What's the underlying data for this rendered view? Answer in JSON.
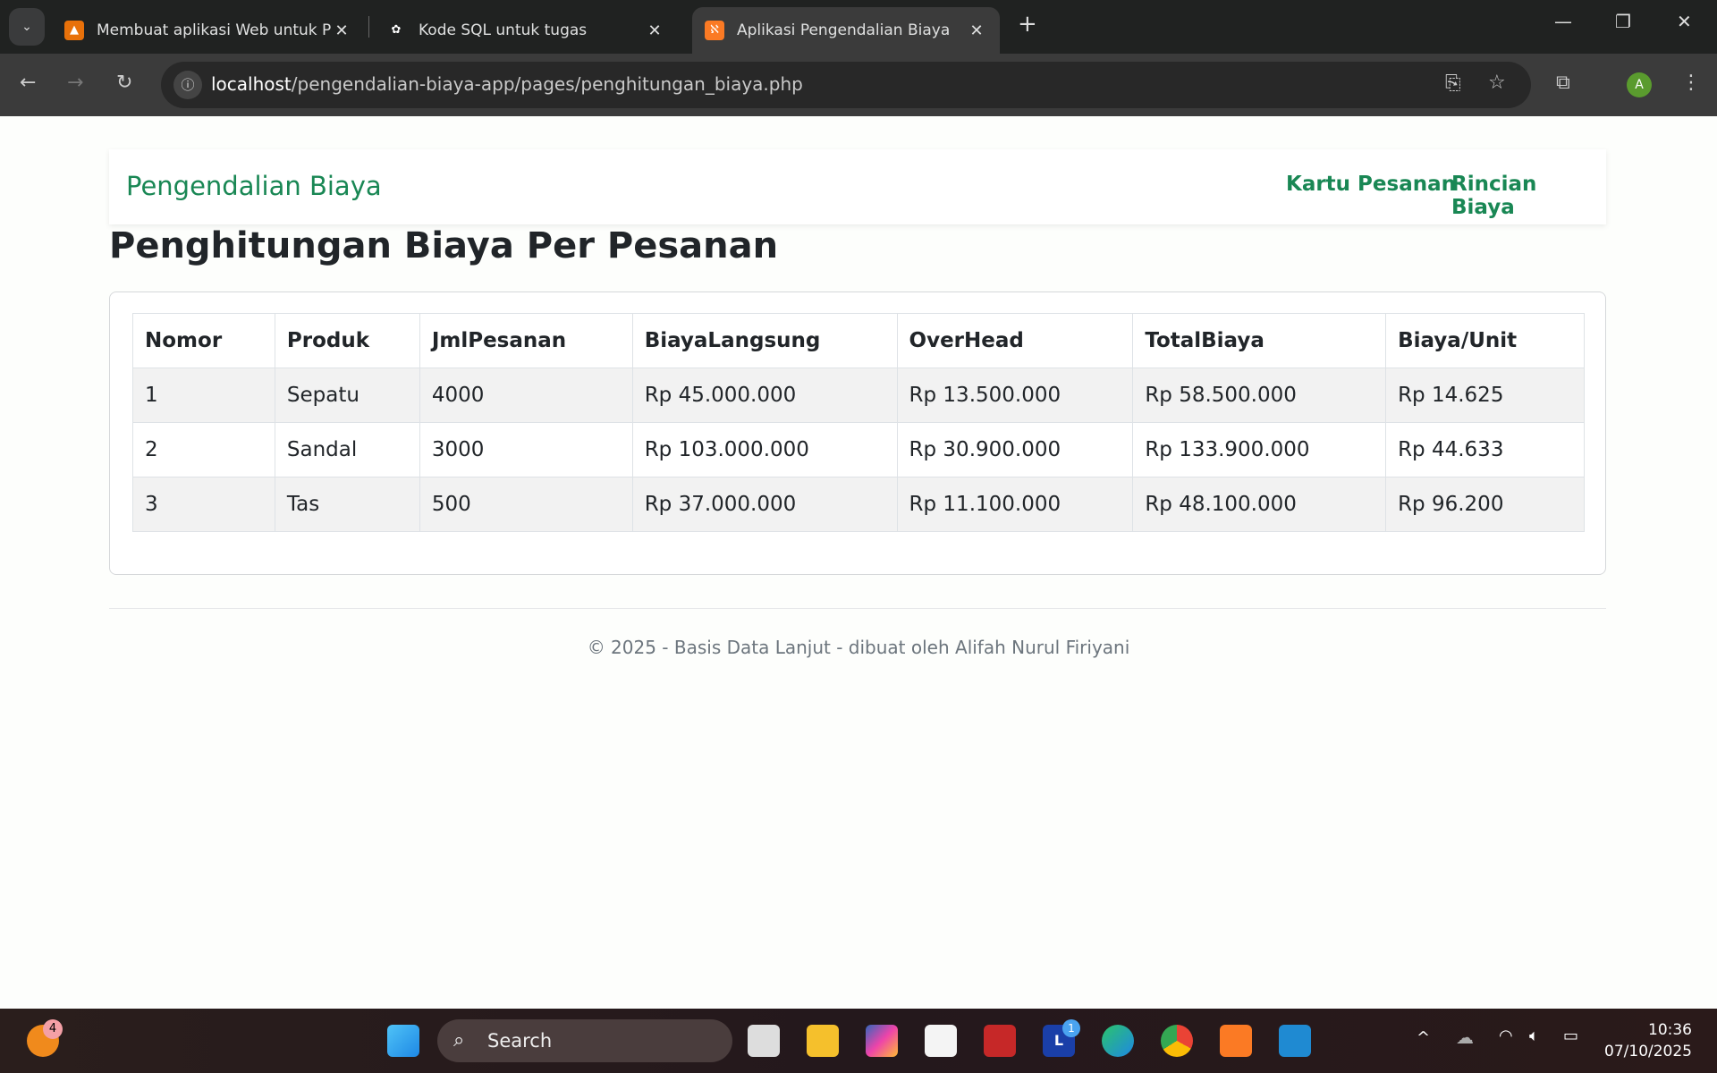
{
  "browser": {
    "tabs": [
      {
        "title": "Membuat aplikasi Web untuk P",
        "icon": "presentation-icon",
        "active": false
      },
      {
        "title": "Kode SQL untuk tugas",
        "icon": "chatgpt-icon",
        "active": false
      },
      {
        "title": "Aplikasi Pengendalian Biaya",
        "icon": "xampp-icon",
        "active": true
      }
    ],
    "url_host": "localhost",
    "url_path": "/pengendalian-biaya-app/pages/penghitungan_biaya.php",
    "profile_initial": "A"
  },
  "navbar": {
    "brand": "Pengendalian Biaya",
    "links": [
      "Kartu Pesanan",
      "Rincian Biaya"
    ],
    "accent": "#198754"
  },
  "page": {
    "title": "Penghitungan Biaya Per Pesanan"
  },
  "table": {
    "headers": [
      "Nomor",
      "Produk",
      "JmlPesanan",
      "BiayaLangsung",
      "OverHead",
      "TotalBiaya",
      "Biaya/Unit"
    ],
    "rows": [
      [
        "1",
        "Sepatu",
        "4000",
        "Rp 45.000.000",
        "Rp 13.500.000",
        "Rp 58.500.000",
        "Rp 14.625"
      ],
      [
        "2",
        "Sandal",
        "3000",
        "Rp 103.000.000",
        "Rp 30.900.000",
        "Rp 133.900.000",
        "Rp 44.633"
      ],
      [
        "3",
        "Tas",
        "500",
        "Rp 37.000.000",
        "Rp 11.100.000",
        "Rp 48.100.000",
        "Rp 96.200"
      ]
    ]
  },
  "footer": {
    "text": "© 2025 - Basis Data Lanjut - dibuat oleh Alifah Nurul Firiyani"
  },
  "taskbar": {
    "search_placeholder": "Search",
    "time": "10:36",
    "date": "07/10/2025",
    "notification_count": "4",
    "l_badge": "1"
  }
}
